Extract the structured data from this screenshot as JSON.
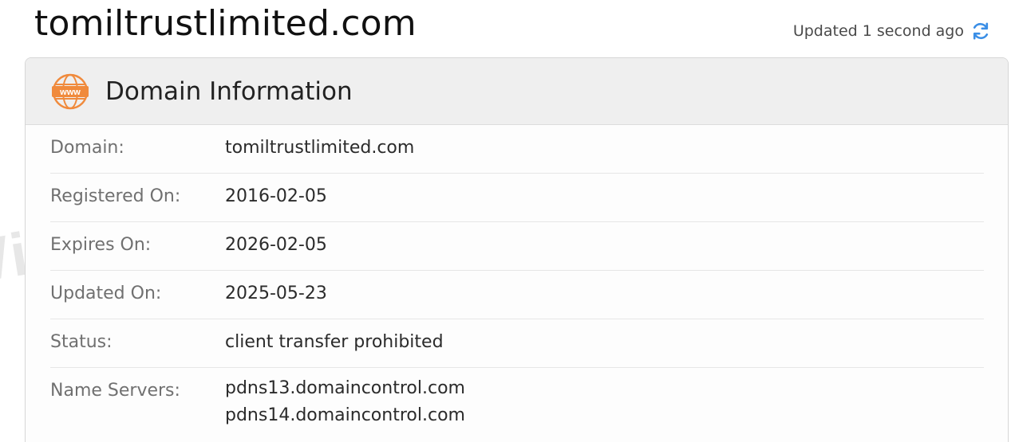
{
  "header": {
    "site_title": "tomiltrustlimited.com",
    "updated_text": "Updated 1 second ago"
  },
  "card": {
    "title": "Domain Information",
    "rows": [
      {
        "label": "Domain:",
        "value": "tomiltrustlimited.com"
      },
      {
        "label": "Registered On:",
        "value": "2016-02-05"
      },
      {
        "label": "Expires On:",
        "value": "2026-02-05"
      },
      {
        "label": "Updated On:",
        "value": "2025-05-23"
      },
      {
        "label": "Status:",
        "value": "client transfer prohibited"
      },
      {
        "label": "Name Servers:",
        "values": [
          "pdns13.domaincontrol.com",
          "pdns14.domaincontrol.com"
        ]
      }
    ]
  },
  "watermark": {
    "text": "WikiFX"
  },
  "icons": {
    "www": "www-globe-icon",
    "refresh": "refresh-icon"
  },
  "colors": {
    "accent_orange": "#f08a3c",
    "refresh_blue": "#3a8ee6"
  }
}
